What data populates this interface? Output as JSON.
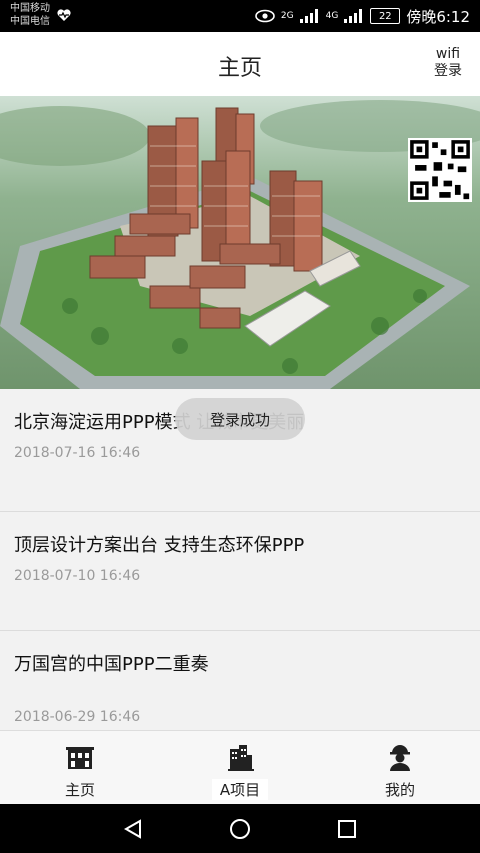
{
  "status_bar": {
    "carrier1": "中国移动",
    "carrier2": "中国电信",
    "net1": "2G",
    "net2": "4G",
    "battery": "22",
    "time": "傍晚6:12"
  },
  "header": {
    "title": "主页",
    "wifi_label": "wifi",
    "login_label": "登录"
  },
  "banner": {
    "image": "housing-development-aerial-rendering",
    "qr": "qr-code"
  },
  "news": [
    {
      "title": "北京海淀运用PPP模式 让城市更美丽",
      "date": "2018-07-16 16:46"
    },
    {
      "title": "顶层设计方案出台 支持生态环保PPP",
      "date": "2018-07-10 16:46"
    },
    {
      "title": "万国宫的中国PPP二重奏",
      "date": "2018-06-29 16:46"
    }
  ],
  "toast": "登录成功",
  "bottom_nav": [
    {
      "label": "主页",
      "icon": "home-building-icon"
    },
    {
      "label": "A项目",
      "icon": "projects-building-icon"
    },
    {
      "label": "我的",
      "icon": "worker-profile-icon"
    }
  ],
  "colors": {
    "status_bar_bg": "#000000",
    "app_bg": "#f2f2f2",
    "toast_bg": "#d2d2d2",
    "date_text": "#9a9a9a"
  }
}
